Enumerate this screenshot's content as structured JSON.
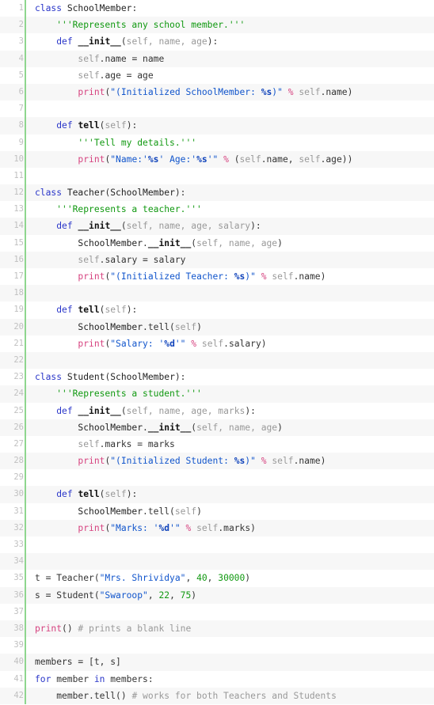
{
  "editor": {
    "language": "python",
    "first_line": 1,
    "last_line": 42,
    "total_lines": 42,
    "colors": {
      "background": "#ffffff",
      "stripe": "#f7f7f7",
      "gutter_bar": "#8ed68e",
      "line_number": "#c0c0c0",
      "keyword": "#2a36c9",
      "string": "#1155cc",
      "docstring": "#119911",
      "comment": "#999999",
      "number": "#119911",
      "builtin": "#d6427f",
      "param": "#999999",
      "text": "#333333"
    }
  },
  "lines": [
    {
      "n": "1",
      "tokens": [
        {
          "t": "class",
          "c": "t-kw"
        },
        {
          "t": " ",
          "c": "t-op"
        },
        {
          "t": "SchoolMember",
          "c": "t-name"
        },
        {
          "t": ":",
          "c": "t-pn"
        }
      ]
    },
    {
      "n": "2",
      "tokens": [
        {
          "t": "    ",
          "c": "t-op"
        },
        {
          "t": "'''Represents any school member.'''",
          "c": "t-doc"
        }
      ]
    },
    {
      "n": "3",
      "tokens": [
        {
          "t": "    ",
          "c": "t-op"
        },
        {
          "t": "def",
          "c": "t-kw"
        },
        {
          "t": " ",
          "c": "t-op"
        },
        {
          "t": "__init__",
          "c": "t-fn"
        },
        {
          "t": "(",
          "c": "t-pn"
        },
        {
          "t": "self, name, age",
          "c": "t-par"
        },
        {
          "t": "):",
          "c": "t-pn"
        }
      ]
    },
    {
      "n": "4",
      "tokens": [
        {
          "t": "        ",
          "c": "t-op"
        },
        {
          "t": "self",
          "c": "t-par"
        },
        {
          "t": ".name = name",
          "c": "t-op"
        }
      ]
    },
    {
      "n": "5",
      "tokens": [
        {
          "t": "        ",
          "c": "t-op"
        },
        {
          "t": "self",
          "c": "t-par"
        },
        {
          "t": ".age = age",
          "c": "t-op"
        }
      ]
    },
    {
      "n": "6",
      "tokens": [
        {
          "t": "        ",
          "c": "t-op"
        },
        {
          "t": "print",
          "c": "t-bi"
        },
        {
          "t": "(",
          "c": "t-pn"
        },
        {
          "t": "\"(Initialized SchoolMember: ",
          "c": "t-str"
        },
        {
          "t": "%s",
          "c": "t-fmt"
        },
        {
          "t": ")\"",
          "c": "t-str"
        },
        {
          "t": " ",
          "c": "t-op"
        },
        {
          "t": "%",
          "c": "t-bi"
        },
        {
          "t": " ",
          "c": "t-op"
        },
        {
          "t": "self",
          "c": "t-par"
        },
        {
          "t": ".name",
          "c": "t-op"
        },
        {
          "t": ")",
          "c": "t-pn"
        }
      ]
    },
    {
      "n": "7",
      "tokens": []
    },
    {
      "n": "8",
      "tokens": [
        {
          "t": "    ",
          "c": "t-op"
        },
        {
          "t": "def",
          "c": "t-kw"
        },
        {
          "t": " ",
          "c": "t-op"
        },
        {
          "t": "tell",
          "c": "t-fn"
        },
        {
          "t": "(",
          "c": "t-pn"
        },
        {
          "t": "self",
          "c": "t-par"
        },
        {
          "t": "):",
          "c": "t-pn"
        }
      ]
    },
    {
      "n": "9",
      "tokens": [
        {
          "t": "        ",
          "c": "t-op"
        },
        {
          "t": "'''Tell my details.'''",
          "c": "t-doc"
        }
      ]
    },
    {
      "n": "10",
      "tokens": [
        {
          "t": "        ",
          "c": "t-op"
        },
        {
          "t": "print",
          "c": "t-bi"
        },
        {
          "t": "(",
          "c": "t-pn"
        },
        {
          "t": "\"Name:'",
          "c": "t-str"
        },
        {
          "t": "%s",
          "c": "t-fmt"
        },
        {
          "t": "' Age:'",
          "c": "t-str"
        },
        {
          "t": "%s",
          "c": "t-fmt"
        },
        {
          "t": "'\"",
          "c": "t-str"
        },
        {
          "t": " ",
          "c": "t-op"
        },
        {
          "t": "%",
          "c": "t-bi"
        },
        {
          "t": " (",
          "c": "t-pn"
        },
        {
          "t": "self",
          "c": "t-par"
        },
        {
          "t": ".name, ",
          "c": "t-op"
        },
        {
          "t": "self",
          "c": "t-par"
        },
        {
          "t": ".age",
          "c": "t-op"
        },
        {
          "t": "))",
          "c": "t-pn"
        }
      ]
    },
    {
      "n": "11",
      "tokens": []
    },
    {
      "n": "12",
      "tokens": [
        {
          "t": "class",
          "c": "t-kw"
        },
        {
          "t": " ",
          "c": "t-op"
        },
        {
          "t": "Teacher",
          "c": "t-name"
        },
        {
          "t": "(",
          "c": "t-pn"
        },
        {
          "t": "SchoolMember",
          "c": "t-name"
        },
        {
          "t": "):",
          "c": "t-pn"
        }
      ]
    },
    {
      "n": "13",
      "tokens": [
        {
          "t": "    ",
          "c": "t-op"
        },
        {
          "t": "'''Represents a teacher.'''",
          "c": "t-doc"
        }
      ]
    },
    {
      "n": "14",
      "tokens": [
        {
          "t": "    ",
          "c": "t-op"
        },
        {
          "t": "def",
          "c": "t-kw"
        },
        {
          "t": " ",
          "c": "t-op"
        },
        {
          "t": "__init__",
          "c": "t-fn"
        },
        {
          "t": "(",
          "c": "t-pn"
        },
        {
          "t": "self, name, age, salary",
          "c": "t-par"
        },
        {
          "t": "):",
          "c": "t-pn"
        }
      ]
    },
    {
      "n": "15",
      "tokens": [
        {
          "t": "        ",
          "c": "t-op"
        },
        {
          "t": "SchoolMember",
          "c": "t-name"
        },
        {
          "t": ".",
          "c": "t-op"
        },
        {
          "t": "__init__",
          "c": "t-fn"
        },
        {
          "t": "(",
          "c": "t-pn"
        },
        {
          "t": "self, name, age",
          "c": "t-par"
        },
        {
          "t": ")",
          "c": "t-pn"
        }
      ]
    },
    {
      "n": "16",
      "tokens": [
        {
          "t": "        ",
          "c": "t-op"
        },
        {
          "t": "self",
          "c": "t-par"
        },
        {
          "t": ".salary = salary",
          "c": "t-op"
        }
      ]
    },
    {
      "n": "17",
      "tokens": [
        {
          "t": "        ",
          "c": "t-op"
        },
        {
          "t": "print",
          "c": "t-bi"
        },
        {
          "t": "(",
          "c": "t-pn"
        },
        {
          "t": "\"(Initialized Teacher: ",
          "c": "t-str"
        },
        {
          "t": "%s",
          "c": "t-fmt"
        },
        {
          "t": ")\"",
          "c": "t-str"
        },
        {
          "t": " ",
          "c": "t-op"
        },
        {
          "t": "%",
          "c": "t-bi"
        },
        {
          "t": " ",
          "c": "t-op"
        },
        {
          "t": "self",
          "c": "t-par"
        },
        {
          "t": ".name",
          "c": "t-op"
        },
        {
          "t": ")",
          "c": "t-pn"
        }
      ]
    },
    {
      "n": "18",
      "tokens": []
    },
    {
      "n": "19",
      "tokens": [
        {
          "t": "    ",
          "c": "t-op"
        },
        {
          "t": "def",
          "c": "t-kw"
        },
        {
          "t": " ",
          "c": "t-op"
        },
        {
          "t": "tell",
          "c": "t-fn"
        },
        {
          "t": "(",
          "c": "t-pn"
        },
        {
          "t": "self",
          "c": "t-par"
        },
        {
          "t": "):",
          "c": "t-pn"
        }
      ]
    },
    {
      "n": "20",
      "tokens": [
        {
          "t": "        ",
          "c": "t-op"
        },
        {
          "t": "SchoolMember",
          "c": "t-name"
        },
        {
          "t": ".tell(",
          "c": "t-op"
        },
        {
          "t": "self",
          "c": "t-par"
        },
        {
          "t": ")",
          "c": "t-pn"
        }
      ]
    },
    {
      "n": "21",
      "tokens": [
        {
          "t": "        ",
          "c": "t-op"
        },
        {
          "t": "print",
          "c": "t-bi"
        },
        {
          "t": "(",
          "c": "t-pn"
        },
        {
          "t": "\"Salary: '",
          "c": "t-str"
        },
        {
          "t": "%d",
          "c": "t-fmt"
        },
        {
          "t": "'\"",
          "c": "t-str"
        },
        {
          "t": " ",
          "c": "t-op"
        },
        {
          "t": "%",
          "c": "t-bi"
        },
        {
          "t": " ",
          "c": "t-op"
        },
        {
          "t": "self",
          "c": "t-par"
        },
        {
          "t": ".salary",
          "c": "t-op"
        },
        {
          "t": ")",
          "c": "t-pn"
        }
      ]
    },
    {
      "n": "22",
      "tokens": []
    },
    {
      "n": "23",
      "tokens": [
        {
          "t": "class",
          "c": "t-kw"
        },
        {
          "t": " ",
          "c": "t-op"
        },
        {
          "t": "Student",
          "c": "t-name"
        },
        {
          "t": "(",
          "c": "t-pn"
        },
        {
          "t": "SchoolMember",
          "c": "t-name"
        },
        {
          "t": "):",
          "c": "t-pn"
        }
      ]
    },
    {
      "n": "24",
      "tokens": [
        {
          "t": "    ",
          "c": "t-op"
        },
        {
          "t": "'''Represents a student.'''",
          "c": "t-doc"
        }
      ]
    },
    {
      "n": "25",
      "tokens": [
        {
          "t": "    ",
          "c": "t-op"
        },
        {
          "t": "def",
          "c": "t-kw"
        },
        {
          "t": " ",
          "c": "t-op"
        },
        {
          "t": "__init__",
          "c": "t-fn"
        },
        {
          "t": "(",
          "c": "t-pn"
        },
        {
          "t": "self, name, age, marks",
          "c": "t-par"
        },
        {
          "t": "):",
          "c": "t-pn"
        }
      ]
    },
    {
      "n": "26",
      "tokens": [
        {
          "t": "        ",
          "c": "t-op"
        },
        {
          "t": "SchoolMember",
          "c": "t-name"
        },
        {
          "t": ".",
          "c": "t-op"
        },
        {
          "t": "__init__",
          "c": "t-fn"
        },
        {
          "t": "(",
          "c": "t-pn"
        },
        {
          "t": "self, name, age",
          "c": "t-par"
        },
        {
          "t": ")",
          "c": "t-pn"
        }
      ]
    },
    {
      "n": "27",
      "tokens": [
        {
          "t": "        ",
          "c": "t-op"
        },
        {
          "t": "self",
          "c": "t-par"
        },
        {
          "t": ".marks = marks",
          "c": "t-op"
        }
      ]
    },
    {
      "n": "28",
      "tokens": [
        {
          "t": "        ",
          "c": "t-op"
        },
        {
          "t": "print",
          "c": "t-bi"
        },
        {
          "t": "(",
          "c": "t-pn"
        },
        {
          "t": "\"(Initialized Student: ",
          "c": "t-str"
        },
        {
          "t": "%s",
          "c": "t-fmt"
        },
        {
          "t": ")\"",
          "c": "t-str"
        },
        {
          "t": " ",
          "c": "t-op"
        },
        {
          "t": "%",
          "c": "t-bi"
        },
        {
          "t": " ",
          "c": "t-op"
        },
        {
          "t": "self",
          "c": "t-par"
        },
        {
          "t": ".name",
          "c": "t-op"
        },
        {
          "t": ")",
          "c": "t-pn"
        }
      ]
    },
    {
      "n": "29",
      "tokens": []
    },
    {
      "n": "30",
      "tokens": [
        {
          "t": "    ",
          "c": "t-op"
        },
        {
          "t": "def",
          "c": "t-kw"
        },
        {
          "t": " ",
          "c": "t-op"
        },
        {
          "t": "tell",
          "c": "t-fn"
        },
        {
          "t": "(",
          "c": "t-pn"
        },
        {
          "t": "self",
          "c": "t-par"
        },
        {
          "t": "):",
          "c": "t-pn"
        }
      ]
    },
    {
      "n": "31",
      "tokens": [
        {
          "t": "        ",
          "c": "t-op"
        },
        {
          "t": "SchoolMember",
          "c": "t-name"
        },
        {
          "t": ".tell(",
          "c": "t-op"
        },
        {
          "t": "self",
          "c": "t-par"
        },
        {
          "t": ")",
          "c": "t-pn"
        }
      ]
    },
    {
      "n": "32",
      "tokens": [
        {
          "t": "        ",
          "c": "t-op"
        },
        {
          "t": "print",
          "c": "t-bi"
        },
        {
          "t": "(",
          "c": "t-pn"
        },
        {
          "t": "\"Marks: '",
          "c": "t-str"
        },
        {
          "t": "%d",
          "c": "t-fmt"
        },
        {
          "t": "'\"",
          "c": "t-str"
        },
        {
          "t": " ",
          "c": "t-op"
        },
        {
          "t": "%",
          "c": "t-bi"
        },
        {
          "t": " ",
          "c": "t-op"
        },
        {
          "t": "self",
          "c": "t-par"
        },
        {
          "t": ".marks",
          "c": "t-op"
        },
        {
          "t": ")",
          "c": "t-pn"
        }
      ]
    },
    {
      "n": "33",
      "tokens": []
    },
    {
      "n": "34",
      "tokens": []
    },
    {
      "n": "35",
      "tokens": [
        {
          "t": "t = Teacher(",
          "c": "t-op"
        },
        {
          "t": "\"Mrs. Shrividya\"",
          "c": "t-str"
        },
        {
          "t": ", ",
          "c": "t-op"
        },
        {
          "t": "40",
          "c": "t-num"
        },
        {
          "t": ", ",
          "c": "t-op"
        },
        {
          "t": "30000",
          "c": "t-num"
        },
        {
          "t": ")",
          "c": "t-pn"
        }
      ]
    },
    {
      "n": "36",
      "tokens": [
        {
          "t": "s = Student(",
          "c": "t-op"
        },
        {
          "t": "\"Swaroop\"",
          "c": "t-str"
        },
        {
          "t": ", ",
          "c": "t-op"
        },
        {
          "t": "22",
          "c": "t-num"
        },
        {
          "t": ", ",
          "c": "t-op"
        },
        {
          "t": "75",
          "c": "t-num"
        },
        {
          "t": ")",
          "c": "t-pn"
        }
      ]
    },
    {
      "n": "37",
      "tokens": []
    },
    {
      "n": "38",
      "tokens": [
        {
          "t": "print",
          "c": "t-bi"
        },
        {
          "t": "() ",
          "c": "t-pn"
        },
        {
          "t": "# prints a blank line",
          "c": "t-com"
        }
      ]
    },
    {
      "n": "39",
      "tokens": []
    },
    {
      "n": "40",
      "tokens": [
        {
          "t": "members = [t, s]",
          "c": "t-op"
        }
      ]
    },
    {
      "n": "41",
      "tokens": [
        {
          "t": "for",
          "c": "t-kw"
        },
        {
          "t": " member ",
          "c": "t-op"
        },
        {
          "t": "in",
          "c": "t-kw"
        },
        {
          "t": " members:",
          "c": "t-op"
        }
      ]
    },
    {
      "n": "42",
      "tokens": [
        {
          "t": "    ",
          "c": "t-op"
        },
        {
          "t": "member.tell() ",
          "c": "t-op"
        },
        {
          "t": "# works for both Teachers and Students",
          "c": "t-com"
        }
      ]
    }
  ],
  "source_text": [
    "class SchoolMember:",
    "    '''Represents any school member.'''",
    "    def __init__(self, name, age):",
    "        self.name = name",
    "        self.age = age",
    "        print(\"(Initialized SchoolMember: %s)\" % self.name)",
    "",
    "    def tell(self):",
    "        '''Tell my details.'''",
    "        print(\"Name:'%s' Age:'%s'\" % (self.name, self.age))",
    "",
    "class Teacher(SchoolMember):",
    "    '''Represents a teacher.'''",
    "    def __init__(self, name, age, salary):",
    "        SchoolMember.__init__(self, name, age)",
    "        self.salary = salary",
    "        print(\"(Initialized Teacher: %s)\" % self.name)",
    "",
    "    def tell(self):",
    "        SchoolMember.tell(self)",
    "        print(\"Salary: '%d'\" % self.salary)",
    "",
    "class Student(SchoolMember):",
    "    '''Represents a student.'''",
    "    def __init__(self, name, age, marks):",
    "        SchoolMember.__init__(self, name, age)",
    "        self.marks = marks",
    "        print(\"(Initialized Student: %s)\" % self.name)",
    "",
    "    def tell(self):",
    "        SchoolMember.tell(self)",
    "        print(\"Marks: '%d'\" % self.marks)",
    "",
    "",
    "t = Teacher(\"Mrs. Shrividya\", 40, 30000)",
    "s = Student(\"Swaroop\", 22, 75)",
    "",
    "print() # prints a blank line",
    "",
    "members = [t, s]",
    "for member in members:",
    "    member.tell() # works for both Teachers and Students"
  ]
}
